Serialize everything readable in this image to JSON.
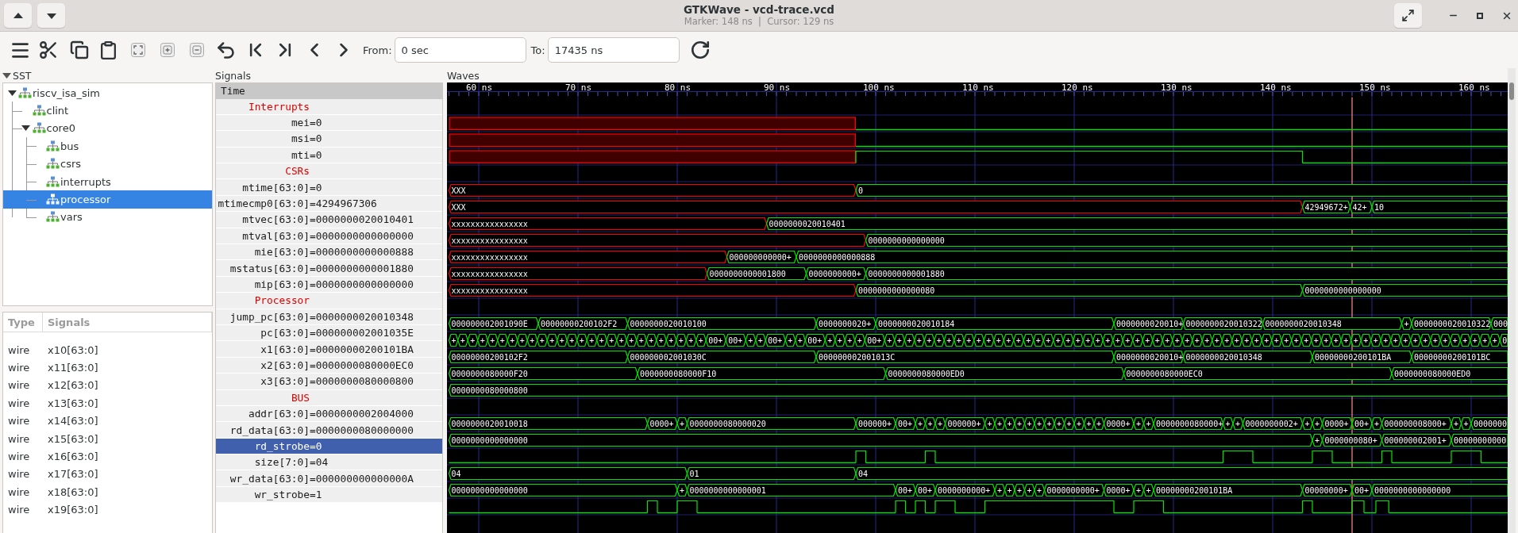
{
  "window": {
    "title": "GTKWave - vcd-trace.vcd",
    "subtitle": "Marker: 148 ns  |  Cursor: 129 ns"
  },
  "toolbar": {
    "from_label": "From:",
    "from_value": "0 sec",
    "to_label": "To:",
    "to_value": "17435 ns"
  },
  "sst": {
    "title": "SST",
    "tree": [
      {
        "label": "riscv_isa_sim",
        "expanded": true,
        "selected": false,
        "children": [
          {
            "label": "clint",
            "selected": false
          },
          {
            "label": "core0",
            "expanded": true,
            "selected": false,
            "children": [
              {
                "label": "bus",
                "selected": false
              },
              {
                "label": "csrs",
                "selected": false
              },
              {
                "label": "interrupts",
                "selected": false
              },
              {
                "label": "processor",
                "selected": true
              },
              {
                "label": "vars",
                "selected": false
              }
            ]
          }
        ]
      }
    ],
    "columns": [
      "Type",
      "Signals"
    ],
    "signals": [
      {
        "type": "wire",
        "name": "x10[63:0]"
      },
      {
        "type": "wire",
        "name": "x11[63:0]"
      },
      {
        "type": "wire",
        "name": "x12[63:0]"
      },
      {
        "type": "wire",
        "name": "x13[63:0]"
      },
      {
        "type": "wire",
        "name": "x14[63:0]"
      },
      {
        "type": "wire",
        "name": "x15[63:0]"
      },
      {
        "type": "wire",
        "name": "x16[63:0]"
      },
      {
        "type": "wire",
        "name": "x17[63:0]"
      },
      {
        "type": "wire",
        "name": "x18[63:0]"
      },
      {
        "type": "wire",
        "name": "x19[63:0]"
      }
    ]
  },
  "signals_title": "Signals",
  "time_header": "Time",
  "waves": {
    "title": "Waves",
    "ruler": [
      "60 ns",
      "70 ns",
      "80 ns",
      "90 ns",
      "100 ns",
      "110 ns",
      "120 ns",
      "130 ns",
      "140 ns",
      "150 ns",
      "160 ns"
    ]
  },
  "rows": [
    {
      "kind": "group",
      "label": "Interrupts",
      "selected": false
    },
    {
      "kind": "bit",
      "name": "mei",
      "value": "=0",
      "selected": false,
      "segments": [
        {
          "unknown": true
        },
        {
          "unknown": false,
          "high": false
        }
      ]
    },
    {
      "kind": "bit",
      "name": "msi",
      "value": "=0",
      "selected": false,
      "segments": [
        {
          "unknown": true
        },
        {
          "unknown": false,
          "high": false
        }
      ]
    },
    {
      "kind": "bit",
      "name": "mti",
      "value": "=0",
      "selected": false,
      "segments": [
        {
          "unknown": true
        },
        {
          "unknown": false,
          "high": true
        },
        {
          "unknown": false,
          "high": false
        }
      ]
    },
    {
      "kind": "group",
      "label": "CSRs",
      "selected": false
    },
    {
      "kind": "bus",
      "name": "mtime[63:0]",
      "value": "=0",
      "selected": false,
      "segments": [
        {
          "unknown": true,
          "v": "XXX"
        },
        {
          "unknown": false,
          "v": "0"
        }
      ]
    },
    {
      "kind": "bus",
      "name": "mtimecmp0[63:0]",
      "value": "=4294967306",
      "selected": false,
      "segments": [
        {
          "unknown": true,
          "v": "XXX"
        },
        {
          "unknown": false,
          "v": "42949672+"
        },
        {
          "unknown": false,
          "v": "42+"
        },
        {
          "unknown": false,
          "v": "10"
        }
      ]
    },
    {
      "kind": "bus",
      "name": "mtvec[63:0]",
      "value": "=0000000020010401",
      "selected": false,
      "segments": [
        {
          "unknown": true,
          "v": "xxxxxxxxxxxxxxxx"
        },
        {
          "unknown": false,
          "v": "0000000020010401"
        }
      ]
    },
    {
      "kind": "bus",
      "name": "mtval[63:0]",
      "value": "=0000000000000000",
      "selected": false,
      "segments": [
        {
          "unknown": true,
          "v": "xxxxxxxxxxxxxxxx"
        },
        {
          "unknown": false,
          "v": "0000000000000000"
        }
      ]
    },
    {
      "kind": "bus",
      "name": "mie[63:0]",
      "value": "=0000000000000888",
      "selected": false,
      "segments": [
        {
          "unknown": true,
          "v": "xxxxxxxxxxxxxxxx"
        },
        {
          "unknown": false,
          "v": "000000000000+"
        },
        {
          "unknown": false,
          "v": "0000000000000888"
        }
      ]
    },
    {
      "kind": "bus",
      "name": "mstatus[63:0]",
      "value": "=0000000000001880",
      "selected": false,
      "segments": [
        {
          "unknown": true,
          "v": "xxxxxxxxxxxxxxxx"
        },
        {
          "unknown": false,
          "v": "0000000000001800"
        },
        {
          "unknown": false,
          "v": "0000000000+"
        },
        {
          "unknown": false,
          "v": "0000000000001880"
        }
      ]
    },
    {
      "kind": "bus",
      "name": "mip[63:0]",
      "value": "=0000000000000000",
      "selected": false,
      "segments": [
        {
          "unknown": true,
          "v": "xxxxxxxxxxxxxxxx"
        },
        {
          "unknown": false,
          "v": "0000000000000080"
        },
        {
          "unknown": false,
          "v": "0000000000000000"
        }
      ]
    },
    {
      "kind": "group",
      "label": "Processor",
      "selected": false
    },
    {
      "kind": "bus",
      "name": "jump_pc[63:0]",
      "value": "=0000000020010348",
      "selected": false,
      "segments": [
        {
          "unknown": false,
          "v": "000000002001090E"
        },
        {
          "unknown": false,
          "v": "00000000200102F2"
        },
        {
          "unknown": false,
          "v": "0000000020010100"
        },
        {
          "unknown": false,
          "v": "0000000020+"
        },
        {
          "unknown": false,
          "v": "0000000020010184"
        },
        {
          "unknown": false,
          "v": "0000000020010+"
        },
        {
          "unknown": false,
          "v": "0000000020010322"
        },
        {
          "unknown": false,
          "v": "0000000020010348"
        },
        {
          "unknown": false,
          "v": "+"
        },
        {
          "unknown": false,
          "v": "0000000020010322"
        },
        {
          "unknown": false,
          "v": "000"
        }
      ]
    },
    {
      "kind": "bus",
      "name": "pc[63:0]",
      "value": "=000000002001035E",
      "selected": false,
      "segments": [
        {
          "unknown": false,
          "v": "+"
        },
        {
          "unknown": false,
          "v": "+"
        },
        {
          "unknown": false,
          "v": "+"
        },
        {
          "unknown": false,
          "v": "+"
        },
        {
          "unknown": false,
          "v": "+"
        },
        {
          "unknown": false,
          "v": "+"
        },
        {
          "unknown": false,
          "v": "+"
        },
        {
          "unknown": false,
          "v": "+"
        },
        {
          "unknown": false,
          "v": "+"
        },
        {
          "unknown": false,
          "v": "+"
        },
        {
          "unknown": false,
          "v": "+"
        },
        {
          "unknown": false,
          "v": "+"
        },
        {
          "unknown": false,
          "v": "+"
        },
        {
          "unknown": false,
          "v": "+"
        },
        {
          "unknown": false,
          "v": "+"
        },
        {
          "unknown": false,
          "v": "+"
        },
        {
          "unknown": false,
          "v": "+"
        },
        {
          "unknown": false,
          "v": "+"
        },
        {
          "unknown": false,
          "v": "+"
        },
        {
          "unknown": false,
          "v": "+"
        },
        {
          "unknown": false,
          "v": "+"
        },
        {
          "unknown": false,
          "v": "+"
        },
        {
          "unknown": false,
          "v": "+"
        },
        {
          "unknown": false,
          "v": "+"
        },
        {
          "unknown": false,
          "v": "+"
        },
        {
          "unknown": false,
          "v": "+"
        },
        {
          "unknown": false,
          "v": "00+"
        },
        {
          "unknown": false,
          "v": "00+"
        },
        {
          "unknown": false,
          "v": "+"
        },
        {
          "unknown": false,
          "v": "+"
        },
        {
          "unknown": false,
          "v": "00+"
        },
        {
          "unknown": false,
          "v": "+"
        },
        {
          "unknown": false,
          "v": "+"
        },
        {
          "unknown": false,
          "v": "00+"
        },
        {
          "unknown": false,
          "v": "+"
        },
        {
          "unknown": false,
          "v": "+"
        },
        {
          "unknown": false,
          "v": "+"
        },
        {
          "unknown": false,
          "v": "+"
        },
        {
          "unknown": false,
          "v": "00+"
        },
        {
          "unknown": false,
          "v": "+"
        },
        {
          "unknown": false,
          "v": "+"
        },
        {
          "unknown": false,
          "v": "+"
        },
        {
          "unknown": false,
          "v": "+"
        },
        {
          "unknown": false,
          "v": "+"
        },
        {
          "unknown": false,
          "v": "+"
        },
        {
          "unknown": false,
          "v": "+"
        },
        {
          "unknown": false,
          "v": "+"
        },
        {
          "unknown": false,
          "v": "+"
        },
        {
          "unknown": false,
          "v": "+"
        },
        {
          "unknown": false,
          "v": "+"
        },
        {
          "unknown": false,
          "v": "+"
        },
        {
          "unknown": false,
          "v": "+"
        },
        {
          "unknown": false,
          "v": "+"
        },
        {
          "unknown": false,
          "v": "+"
        },
        {
          "unknown": false,
          "v": "+"
        },
        {
          "unknown": false,
          "v": "+"
        },
        {
          "unknown": false,
          "v": "+"
        },
        {
          "unknown": false,
          "v": "+"
        },
        {
          "unknown": false,
          "v": "+"
        },
        {
          "unknown": false,
          "v": "+"
        },
        {
          "unknown": false,
          "v": "+"
        },
        {
          "unknown": false,
          "v": "+"
        },
        {
          "unknown": false,
          "v": "+"
        },
        {
          "unknown": false,
          "v": "+"
        },
        {
          "unknown": false,
          "v": "+"
        },
        {
          "unknown": false,
          "v": "+"
        },
        {
          "unknown": false,
          "v": "+"
        },
        {
          "unknown": false,
          "v": "+"
        },
        {
          "unknown": false,
          "v": "+"
        },
        {
          "unknown": false,
          "v": "+"
        },
        {
          "unknown": false,
          "v": "+"
        },
        {
          "unknown": false,
          "v": "+"
        },
        {
          "unknown": false,
          "v": "+"
        },
        {
          "unknown": false,
          "v": "+"
        },
        {
          "unknown": false,
          "v": "+"
        },
        {
          "unknown": false,
          "v": "+"
        },
        {
          "unknown": false,
          "v": "+"
        },
        {
          "unknown": false,
          "v": "+"
        },
        {
          "unknown": false,
          "v": "+"
        },
        {
          "unknown": false,
          "v": "+"
        },
        {
          "unknown": false,
          "v": "+"
        },
        {
          "unknown": false,
          "v": "+"
        },
        {
          "unknown": false,
          "v": "+"
        },
        {
          "unknown": false,
          "v": "+"
        },
        {
          "unknown": false,
          "v": "+"
        },
        {
          "unknown": false,
          "v": "+"
        },
        {
          "unknown": false,
          "v": "+"
        },
        {
          "unknown": false,
          "v": "+"
        },
        {
          "unknown": false,
          "v": "+"
        },
        {
          "unknown": false,
          "v": "+"
        },
        {
          "unknown": false,
          "v": "+"
        },
        {
          "unknown": false,
          "v": "+"
        },
        {
          "unknown": false,
          "v": "+"
        },
        {
          "unknown": false,
          "v": "+"
        },
        {
          "unknown": false,
          "v": "+"
        },
        {
          "unknown": false,
          "v": "+"
        },
        {
          "unknown": false,
          "v": "+"
        },
        {
          "unknown": false,
          "v": "+"
        },
        {
          "unknown": false,
          "v": "+"
        },
        {
          "unknown": false,
          "v": "+"
        },
        {
          "unknown": false,
          "v": "+"
        },
        {
          "unknown": false,
          "v": "0"
        }
      ]
    },
    {
      "kind": "bus",
      "name": "x1[63:0]",
      "value": "=00000000200101BA",
      "selected": false,
      "segments": [
        {
          "unknown": false,
          "v": "00000000200102F2"
        },
        {
          "unknown": false,
          "v": "000000002001030C"
        },
        {
          "unknown": false,
          "v": "000000002001013C"
        },
        {
          "unknown": false,
          "v": "0000000020010+"
        },
        {
          "unknown": false,
          "v": "0000000020010348"
        },
        {
          "unknown": false,
          "v": "00000000200101BA"
        },
        {
          "unknown": false,
          "v": "00000000200101BC"
        }
      ]
    },
    {
      "kind": "bus",
      "name": "x2[63:0]",
      "value": "=0000000080000EC0",
      "selected": false,
      "segments": [
        {
          "unknown": false,
          "v": "0000000080000F20"
        },
        {
          "unknown": false,
          "v": "0000000080000F10"
        },
        {
          "unknown": false,
          "v": "0000000080000ED0"
        },
        {
          "unknown": false,
          "v": "0000000080000EC0"
        },
        {
          "unknown": false,
          "v": "0000000080000ED0"
        }
      ]
    },
    {
      "kind": "bus",
      "name": "x3[63:0]",
      "value": "=0000000080000800",
      "selected": false,
      "segments": [
        {
          "unknown": false,
          "v": "0000000080000800"
        }
      ]
    },
    {
      "kind": "group",
      "label": "BUS",
      "selected": false
    },
    {
      "kind": "bus",
      "name": "addr[63:0]",
      "value": "=0000000002004000",
      "selected": false,
      "segments": [
        {
          "unknown": false,
          "v": "0000000020010018"
        },
        {
          "unknown": false,
          "v": "0000+"
        },
        {
          "unknown": false,
          "v": "+"
        },
        {
          "unknown": false,
          "v": "0000000080000020"
        },
        {
          "unknown": false,
          "v": "000000+"
        },
        {
          "unknown": false,
          "v": "00+"
        },
        {
          "unknown": false,
          "v": "+"
        },
        {
          "unknown": false,
          "v": "+"
        },
        {
          "unknown": false,
          "v": "+"
        },
        {
          "unknown": false,
          "v": "000000+"
        },
        {
          "unknown": false,
          "v": "+"
        },
        {
          "unknown": false,
          "v": "+"
        },
        {
          "unknown": false,
          "v": "+"
        },
        {
          "unknown": false,
          "v": "+"
        },
        {
          "unknown": false,
          "v": "+"
        },
        {
          "unknown": false,
          "v": "+"
        },
        {
          "unknown": false,
          "v": "+"
        },
        {
          "unknown": false,
          "v": "+"
        },
        {
          "unknown": false,
          "v": "+"
        },
        {
          "unknown": false,
          "v": "+"
        },
        {
          "unknown": false,
          "v": "+"
        },
        {
          "unknown": false,
          "v": "+"
        },
        {
          "unknown": false,
          "v": "0000+"
        },
        {
          "unknown": false,
          "v": "+"
        },
        {
          "unknown": false,
          "v": "+"
        },
        {
          "unknown": false,
          "v": "0000000080000+"
        },
        {
          "unknown": false,
          "v": "+"
        },
        {
          "unknown": false,
          "v": "+"
        },
        {
          "unknown": false,
          "v": "0000000002+"
        },
        {
          "unknown": false,
          "v": "+"
        },
        {
          "unknown": false,
          "v": "+"
        },
        {
          "unknown": false,
          "v": "0000+"
        },
        {
          "unknown": false,
          "v": "00+"
        },
        {
          "unknown": false,
          "v": "+"
        },
        {
          "unknown": false,
          "v": "000000008000+"
        },
        {
          "unknown": false,
          "v": "+"
        },
        {
          "unknown": false,
          "v": "+"
        },
        {
          "unknown": false,
          "v": "0000000"
        }
      ]
    },
    {
      "kind": "bus",
      "name": "rd_data[63:0]",
      "value": "=0000000080000000",
      "selected": false,
      "segments": [
        {
          "unknown": false,
          "v": "0000000000000000"
        },
        {
          "unknown": false,
          "v": "+"
        },
        {
          "unknown": false,
          "v": "0000000080+"
        },
        {
          "unknown": false,
          "v": "000000002001+"
        },
        {
          "unknown": false,
          "v": "00000000000"
        }
      ]
    },
    {
      "kind": "bit",
      "name": "rd_strobe",
      "value": "=0",
      "selected": true,
      "segments": [
        {
          "unknown": false,
          "high": false
        },
        {
          "unknown": false,
          "high": true
        },
        {
          "unknown": false,
          "high": false
        },
        {
          "unknown": false,
          "high": true
        },
        {
          "unknown": false,
          "high": false
        },
        {
          "unknown": false,
          "high": true
        },
        {
          "unknown": false,
          "high": false
        },
        {
          "unknown": false,
          "high": true
        },
        {
          "unknown": false,
          "high": false
        },
        {
          "unknown": false,
          "high": true
        },
        {
          "unknown": false,
          "high": false
        },
        {
          "unknown": false,
          "high": true
        },
        {
          "unknown": false,
          "high": false
        }
      ]
    },
    {
      "kind": "bus",
      "name": "size[7:0]",
      "value": "=04",
      "selected": false,
      "segments": [
        {
          "unknown": false,
          "v": "04"
        },
        {
          "unknown": false,
          "v": "01"
        },
        {
          "unknown": false,
          "v": "04"
        }
      ]
    },
    {
      "kind": "bus",
      "name": "wr_data[63:0]",
      "value": "=000000000000000A",
      "selected": false,
      "segments": [
        {
          "unknown": false,
          "v": "0000000000000000"
        },
        {
          "unknown": false,
          "v": "+"
        },
        {
          "unknown": false,
          "v": "0000000000000001"
        },
        {
          "unknown": false,
          "v": "00+"
        },
        {
          "unknown": false,
          "v": "00+"
        },
        {
          "unknown": false,
          "v": "0000000000+"
        },
        {
          "unknown": false,
          "v": "+"
        },
        {
          "unknown": false,
          "v": "+"
        },
        {
          "unknown": false,
          "v": "+"
        },
        {
          "unknown": false,
          "v": "+"
        },
        {
          "unknown": false,
          "v": "+"
        },
        {
          "unknown": false,
          "v": "0000000000+"
        },
        {
          "unknown": false,
          "v": "0000+"
        },
        {
          "unknown": false,
          "v": "+"
        },
        {
          "unknown": false,
          "v": "+"
        },
        {
          "unknown": false,
          "v": "00000000200101BA"
        },
        {
          "unknown": false,
          "v": "00000000+"
        },
        {
          "unknown": false,
          "v": "00+"
        },
        {
          "unknown": false,
          "v": "0000000000000000"
        }
      ]
    },
    {
      "kind": "bit",
      "name": "wr_strobe",
      "value": "=1",
      "selected": false,
      "segments": [
        {
          "unknown": false,
          "high": false
        },
        {
          "unknown": false,
          "high": true
        },
        {
          "unknown": false,
          "high": false
        },
        {
          "unknown": false,
          "high": true
        },
        {
          "unknown": false,
          "high": false
        },
        {
          "unknown": false,
          "high": true
        },
        {
          "unknown": false,
          "high": false
        },
        {
          "unknown": false,
          "high": true
        },
        {
          "unknown": false,
          "high": false
        },
        {
          "unknown": false,
          "high": true
        },
        {
          "unknown": false,
          "high": false
        },
        {
          "unknown": false,
          "high": true
        },
        {
          "unknown": false,
          "high": false
        },
        {
          "unknown": false,
          "high": true
        },
        {
          "unknown": false,
          "high": false
        },
        {
          "unknown": false,
          "high": true
        },
        {
          "unknown": false,
          "high": false
        },
        {
          "unknown": false,
          "high": true
        },
        {
          "unknown": false,
          "high": false
        },
        {
          "unknown": false,
          "high": true
        },
        {
          "unknown": false,
          "high": false
        }
      ]
    }
  ]
}
